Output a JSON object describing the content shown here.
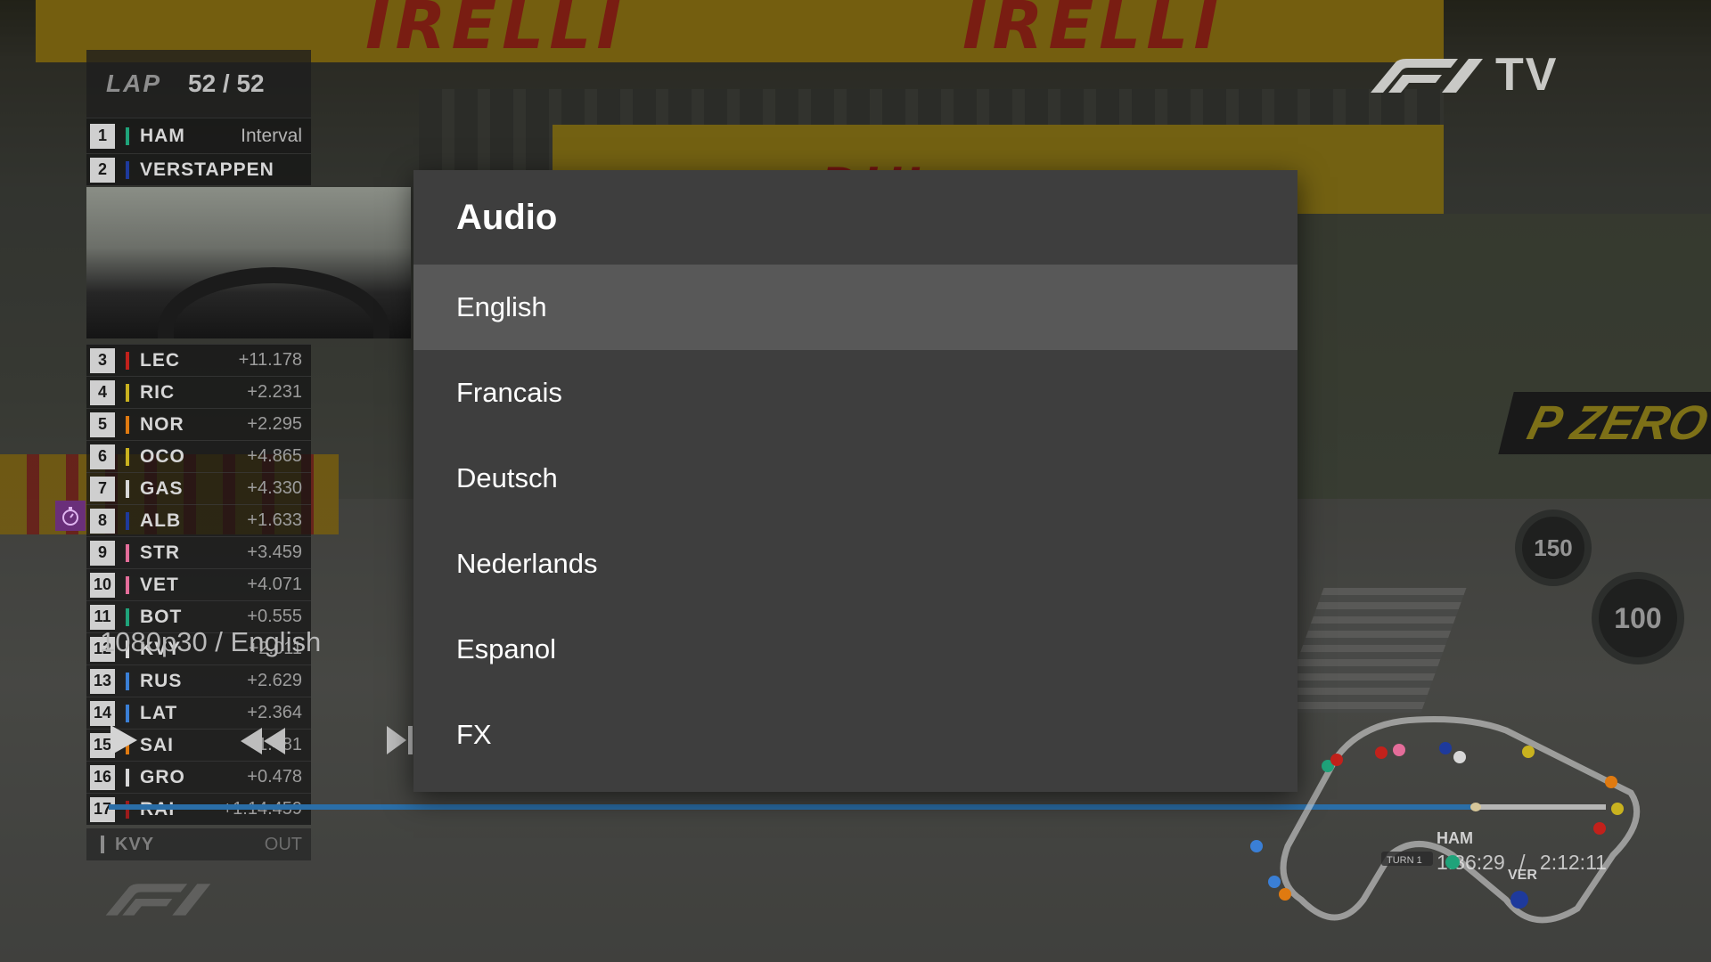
{
  "app": {
    "logo_text": "TV"
  },
  "timing_tower": {
    "lap_label": "LAP",
    "lap_count": "52 / 52",
    "leader": {
      "pos": "1",
      "code": "HAM",
      "gap": "Interval",
      "team_color": "#1fa37a"
    },
    "second": {
      "pos": "2",
      "code": "VERSTAPPEN",
      "team_color": "#1e3a9c"
    },
    "rows": [
      {
        "pos": "3",
        "code": "LEC",
        "gap": "+11.178",
        "team_color": "#c2211b"
      },
      {
        "pos": "4",
        "code": "RIC",
        "gap": "+2.231",
        "team_color": "#c9b21f"
      },
      {
        "pos": "5",
        "code": "NOR",
        "gap": "+2.295",
        "team_color": "#e07a10"
      },
      {
        "pos": "6",
        "code": "OCO",
        "gap": "+4.865",
        "team_color": "#c9b21f"
      },
      {
        "pos": "7",
        "code": "GAS",
        "gap": "+4.330",
        "team_color": "#d8d8d8"
      },
      {
        "pos": "8",
        "code": "ALB",
        "gap": "+1.633",
        "team_color": "#1e3a9c"
      },
      {
        "pos": "9",
        "code": "STR",
        "gap": "+3.459",
        "team_color": "#e46d9a"
      },
      {
        "pos": "10",
        "code": "VET",
        "gap": "+4.071",
        "team_color": "#e46d9a"
      },
      {
        "pos": "11",
        "code": "BOT",
        "gap": "+0.555",
        "team_color": "#1fa37a"
      },
      {
        "pos": "12",
        "code": "KVY",
        "gap": "+2.011",
        "team_color": "#d8d8d8"
      },
      {
        "pos": "13",
        "code": "RUS",
        "gap": "+2.629",
        "team_color": "#3a7fd6"
      },
      {
        "pos": "14",
        "code": "LAT",
        "gap": "+2.364",
        "team_color": "#3a7fd6"
      },
      {
        "pos": "15",
        "code": "SAI",
        "gap": "+1.481",
        "team_color": "#e07a10"
      },
      {
        "pos": "16",
        "code": "GRO",
        "gap": "+0.478",
        "team_color": "#d8d8d8"
      },
      {
        "pos": "17",
        "code": "RAI",
        "gap": "+1:14.459",
        "team_color": "#9c1b1b"
      }
    ],
    "out_row": {
      "code": "KVY",
      "gap": "OUT",
      "team_color": "#8c8c8c"
    }
  },
  "player": {
    "quality_label": "1080p30 / English",
    "progress": 0.913,
    "current_time": "1:36:29",
    "separator": "/",
    "total_time": "2:12:11"
  },
  "circuit": {
    "driver_label_1": "HAM",
    "driver_label_2": "VER",
    "turn_label": "TURN 1"
  },
  "audio_dialog": {
    "title": "Audio",
    "selected_index": 0,
    "options": [
      "English",
      "Francais",
      "Deutsch",
      "Nederlands",
      "Espanol",
      "FX"
    ]
  },
  "background": {
    "banner_brand": "IRELLI",
    "sponsor": "DHL",
    "pzero": "P ZERO",
    "speed_sign_1": "150",
    "speed_sign_2": "100"
  },
  "colors": {
    "dialog_bg": "#3e3e3e",
    "dialog_selected": "#585858",
    "progress_fill": "#2a6ea8",
    "fastest_lap_purple": "#6a2f7a"
  }
}
